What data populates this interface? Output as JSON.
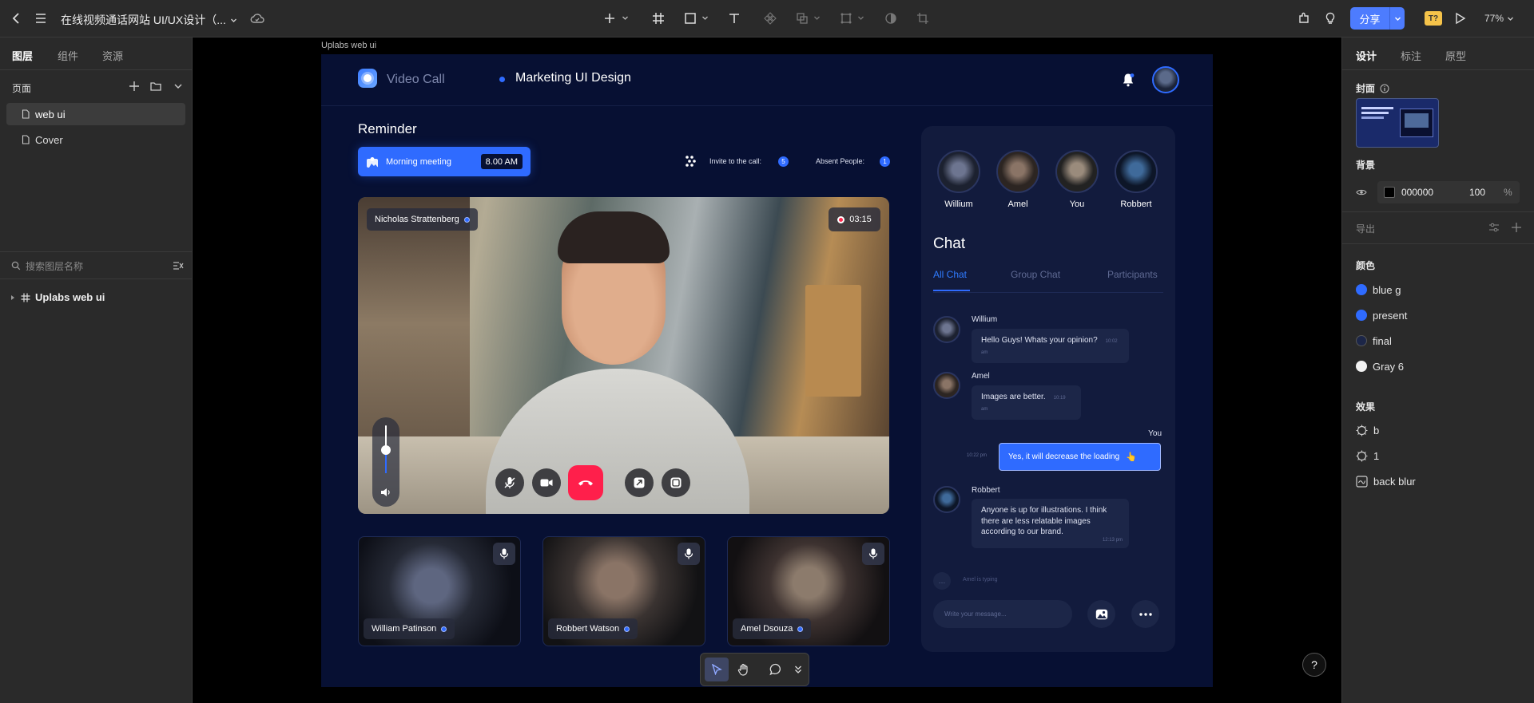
{
  "topbar": {
    "title": "在线视频通话网站 UI/UX设计（...",
    "share_label": "分享",
    "badge_label": "T?",
    "zoom": "77%"
  },
  "left_panel": {
    "tabs": [
      "图层",
      "组件",
      "资源"
    ],
    "pages_title": "页面",
    "pages": [
      "web ui",
      "Cover"
    ],
    "search_placeholder": "搜索图层名称",
    "layer": "Uplabs web ui"
  },
  "right_panel": {
    "tabs": [
      "设计",
      "标注",
      "原型"
    ],
    "cover_title": "封面",
    "bg_title": "背景",
    "bg_hex": "000000",
    "bg_opacity": "100",
    "bg_percent": "%",
    "export_title": "导出",
    "colors_title": "颜色",
    "colors": [
      {
        "name": "blue g",
        "hex": "#2f6bff"
      },
      {
        "name": "present",
        "hex": "#2f6bff"
      },
      {
        "name": "final",
        "hex": "#1c2648"
      },
      {
        "name": "Gray 6",
        "hex": "#f2f2f2"
      }
    ],
    "effects_title": "效果",
    "effects": [
      {
        "name": "b",
        "icon": "shadow-icon"
      },
      {
        "name": "1",
        "icon": "shadow-icon"
      },
      {
        "name": "back blur",
        "icon": "blur-icon"
      }
    ]
  },
  "canvas": {
    "frame_label": "Uplabs web ui",
    "help": "?"
  },
  "app": {
    "brand": "Video Call",
    "project": "Marketing UI Design",
    "reminder_title": "Reminder",
    "meeting_label": "Morning meeting",
    "meeting_time": "8.00 AM",
    "invite_label": "Invite to the call:",
    "invite_count": "5",
    "absent_label": "Absent People:",
    "absent_count": "1",
    "main_speaker": "Nicholas Strattenberg",
    "timer": "03:15",
    "tiles": [
      "William Patinson",
      "Robbert Watson",
      "Amel Dsouza"
    ],
    "participants": [
      "Willium",
      "Amel",
      "You",
      "Robbert"
    ],
    "chat_title": "Chat",
    "chat_tabs": [
      "All Chat",
      "Group Chat",
      "Participants"
    ],
    "messages": [
      {
        "name": "Willium",
        "text": "Hello Guys! Whats your opinion?",
        "time": "10:02 am"
      },
      {
        "name": "Amel",
        "text": "Images are better.",
        "time": "10:19 am"
      },
      {
        "name": "You",
        "text": "Yes, it will decrease the loading",
        "time": "10:22 pm"
      },
      {
        "name": "Robbert",
        "text": "Anyone is up for illustrations. I think there are less relatable images according to our brand.",
        "time": "12:13 pm"
      }
    ],
    "typing": "Amel is typing",
    "input_placeholder": "Write your message..."
  }
}
